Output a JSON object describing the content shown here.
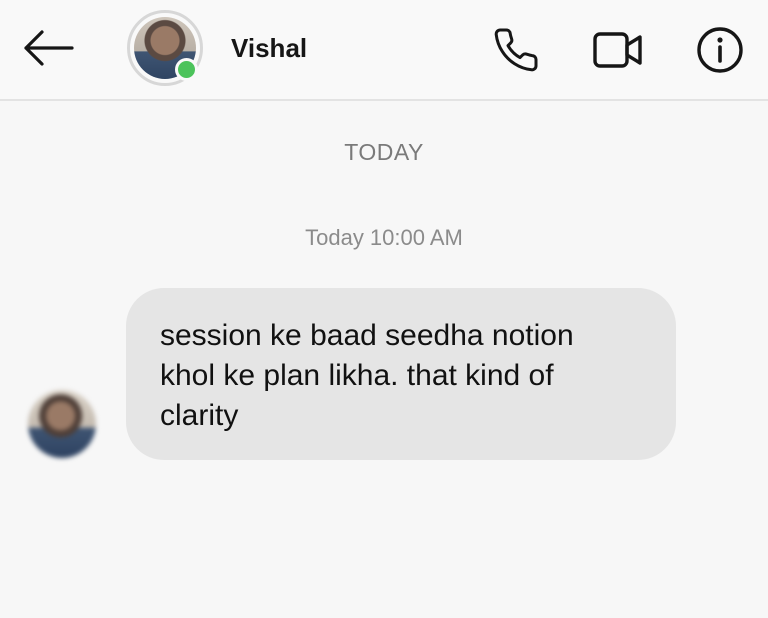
{
  "header": {
    "contact_name": "Vishal",
    "online": true,
    "icons": [
      "back-arrow-icon",
      "phone-icon",
      "video-camera-icon",
      "info-icon"
    ]
  },
  "conversation": {
    "date_separator": "TODAY",
    "messages": [
      {
        "timestamp": "Today 10:00 AM",
        "sender": "Vishal",
        "lines": [
          "session ke baad seedha notion",
          "khol ke plan likha. that kind of",
          "clarity"
        ]
      }
    ]
  },
  "colors": {
    "background": "#f7f7f7",
    "bubble": "#e5e5e5",
    "online_indicator": "#4cc35b",
    "meta_text": "#7a7a7a"
  }
}
